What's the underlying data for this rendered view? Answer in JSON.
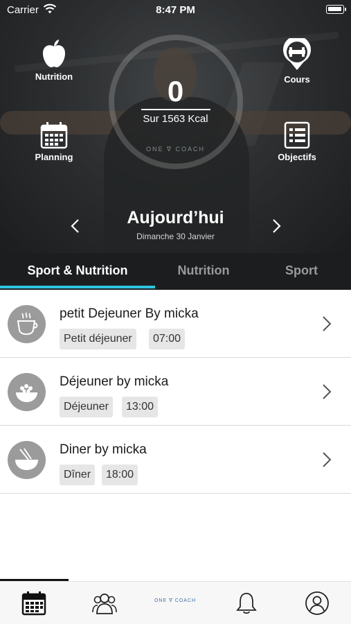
{
  "status_bar": {
    "carrier": "Carrier",
    "time": "8:47 PM"
  },
  "calories": {
    "value": "0",
    "label": "Sur 1563 Kcal"
  },
  "brand": {
    "logo_text": "ONE ∇ COACH"
  },
  "quick_actions": {
    "nutrition": "Nutrition",
    "cours": "Cours",
    "planning": "Planning",
    "objectifs": "Objectifs"
  },
  "date_nav": {
    "title": "Aujourd’hui",
    "subtitle": "Dimanche 30 Janvier"
  },
  "tabs": {
    "sport_nutrition": "Sport & Nutrition",
    "nutrition": "Nutrition",
    "sport": "Sport"
  },
  "meals": [
    {
      "title": "petit Dejeuner By micka",
      "type": "Petit déjeuner",
      "time": "07:00",
      "icon": "coffee-cup-icon"
    },
    {
      "title": "Déjeuner by micka",
      "type": "Déjeuner",
      "time": "13:00",
      "icon": "salad-bowl-icon"
    },
    {
      "title": "Diner by micka",
      "type": "Dîner",
      "time": "18:00",
      "icon": "noodle-bowl-icon"
    }
  ],
  "colors": {
    "accent": "#2ec5e0",
    "tab_bg": "#1c1d1f",
    "tag_bg": "#e6e6e6"
  }
}
